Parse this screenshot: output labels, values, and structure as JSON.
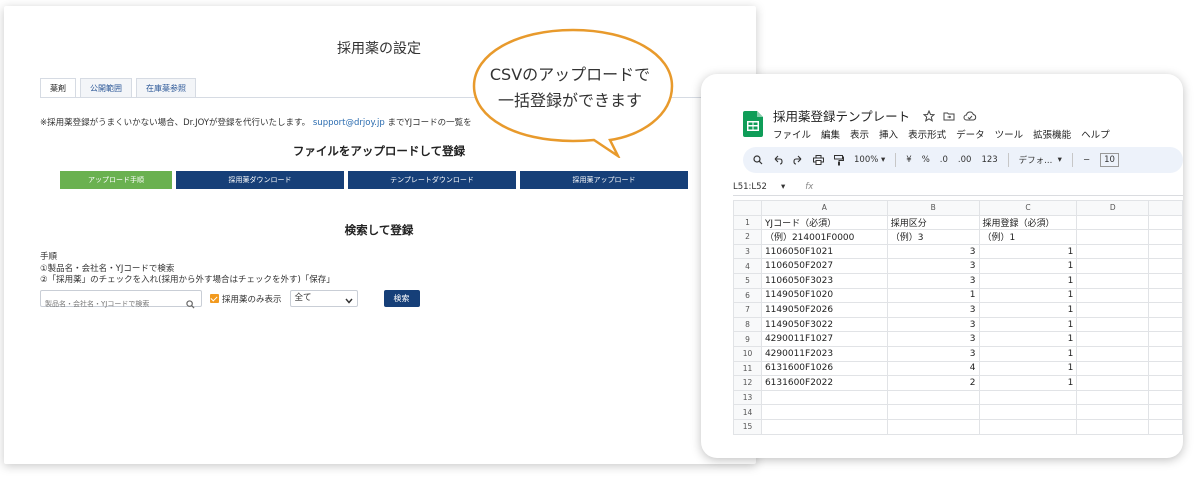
{
  "left": {
    "title": "採用薬の設定",
    "tabs": [
      "薬剤",
      "公開範囲",
      "在庫薬参照"
    ],
    "notice_prefix": "※採用薬登録がうまくいかない場合、Dr.JOYが登録を代行いたします。",
    "notice_email": "support@drjoy.jp",
    "notice_suffix": "までYJコードの一覧を",
    "upload_section_title": "ファイルをアップロードして登録",
    "buttons": [
      "アップロード手順",
      "採用薬ダウンロード",
      "テンプレートダウンロード",
      "採用薬アップロード"
    ],
    "search_section_title": "検索して登録",
    "procedure_heading": "手順",
    "procedure_step1": "①製品名・会社名・YJコードで検索",
    "procedure_step2": "②「採用薬」のチェックを入れ(採用から外す場合はチェックを外す)「保存」",
    "search_placeholder": "製品名・会社名・YJコードで検索",
    "checkbox_label": "採用薬のみ表示",
    "filter_value": "全て",
    "search_button": "検索"
  },
  "bubble": {
    "line1": "CSVのアップロードで",
    "line2": "一括登録ができます",
    "color": "#e89a2c"
  },
  "sheet": {
    "title": "採用薬登録テンプレート",
    "menu": [
      "ファイル",
      "編集",
      "表示",
      "挿入",
      "表示形式",
      "データ",
      "ツール",
      "拡張機能",
      "ヘルプ"
    ],
    "toolbar": {
      "zoom": "100%",
      "currency": "¥",
      "percent": "%",
      "dec_decrease": ".0",
      "dec_increase": ".00",
      "number_format": "123",
      "font": "デフォ...",
      "minus": "−",
      "font_size": "10"
    },
    "cell_ref": "L51:L52",
    "fx": "fx",
    "columns": [
      "A",
      "B",
      "C",
      "D"
    ],
    "rows": [
      {
        "n": "1",
        "a": "YJコード（必須）",
        "b": "採用区分",
        "c": "採用登録（必須）"
      },
      {
        "n": "2",
        "a": "（例）214001F0000",
        "b": "（例）3",
        "c": "（例）1"
      },
      {
        "n": "3",
        "a": "1106050F1021",
        "b": "3",
        "c": "1"
      },
      {
        "n": "4",
        "a": "1106050F2027",
        "b": "3",
        "c": "1"
      },
      {
        "n": "5",
        "a": "1106050F3023",
        "b": "3",
        "c": "1"
      },
      {
        "n": "6",
        "a": "1149050F1020",
        "b": "1",
        "c": "1"
      },
      {
        "n": "7",
        "a": "1149050F2026",
        "b": "3",
        "c": "1"
      },
      {
        "n": "8",
        "a": "1149050F3022",
        "b": "3",
        "c": "1"
      },
      {
        "n": "9",
        "a": "4290011F1027",
        "b": "3",
        "c": "1"
      },
      {
        "n": "10",
        "a": "4290011F2023",
        "b": "3",
        "c": "1"
      },
      {
        "n": "11",
        "a": "6131600F1026",
        "b": "4",
        "c": "1"
      },
      {
        "n": "12",
        "a": "6131600F2022",
        "b": "2",
        "c": "1"
      },
      {
        "n": "13",
        "a": "",
        "b": "",
        "c": ""
      },
      {
        "n": "14",
        "a": "",
        "b": "",
        "c": ""
      },
      {
        "n": "15",
        "a": "",
        "b": "",
        "c": ""
      }
    ]
  }
}
